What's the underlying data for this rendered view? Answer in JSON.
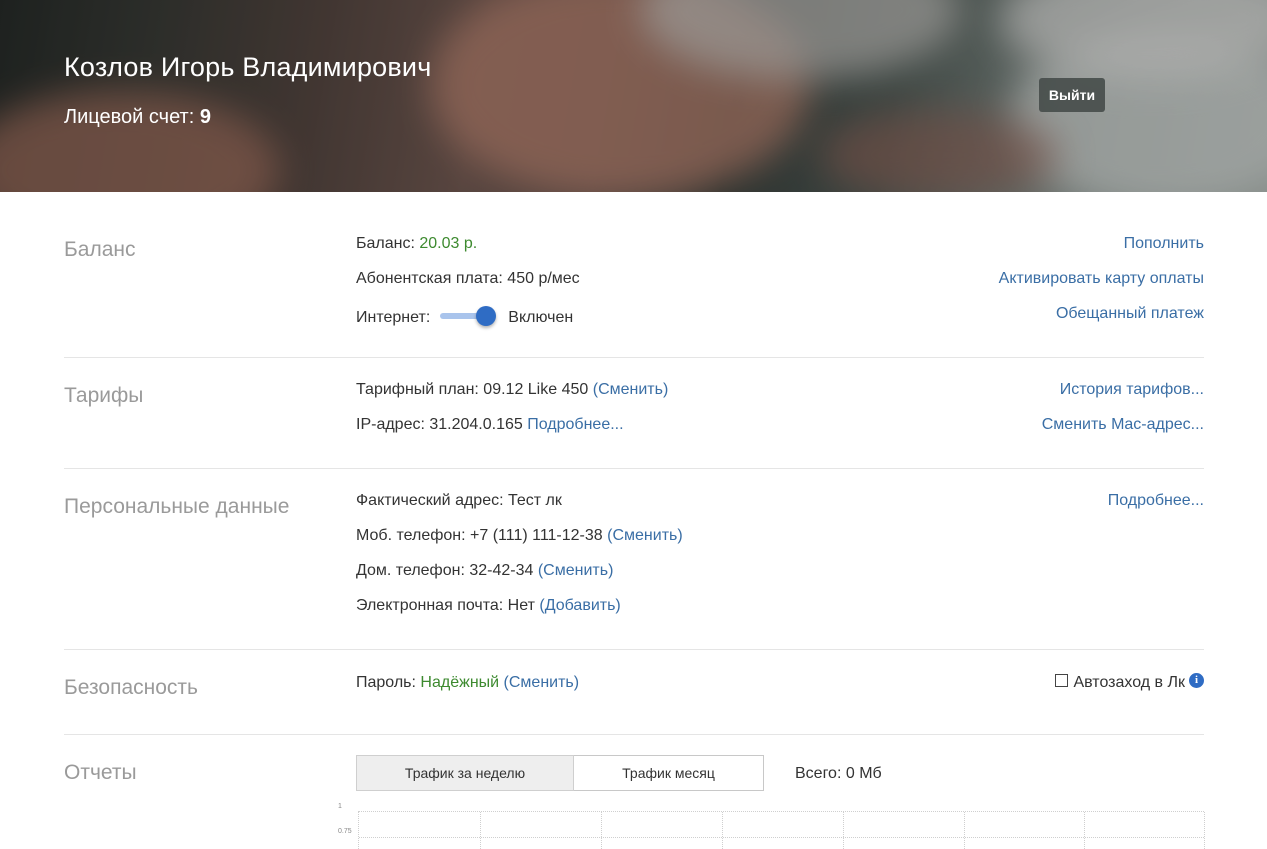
{
  "header": {
    "user_name": "Козлов Игорь Владимирович",
    "account_label": "Лицевой счет:",
    "account_number": "9",
    "logout_label": "Выйти"
  },
  "balance": {
    "title": "Баланс",
    "balance_label": "Баланс:",
    "balance_value": "20.03 р.",
    "fee_text": "Абонентская плата: 450 р/мес",
    "internet_label": "Интернет:",
    "internet_on": true,
    "internet_status": "Включен",
    "links": [
      "Пополнить",
      "Активировать карту оплаты",
      "Обещанный платеж"
    ]
  },
  "tariffs": {
    "title": "Тарифы",
    "plan_text": "Тарифный план: 09.12 Like 450",
    "plan_change": "(Сменить)",
    "ip_text": "IP-адрес: 31.204.0.165",
    "ip_more": "Подробнее...",
    "links": [
      "История тарифов...",
      "Сменить Mac-адрес..."
    ]
  },
  "personal": {
    "title": "Персональные данные",
    "address_text": "Фактический адрес: Тест лк",
    "mobile_text": "Моб. телефон: +7 (111) 111-12-38",
    "mobile_change": "(Сменить)",
    "home_text": "Дом. телефон: 32-42-34",
    "home_change": "(Сменить)",
    "email_text": "Электронная почта: Нет",
    "email_add": "(Добавить)",
    "more_link": "Подробнее..."
  },
  "security": {
    "title": "Безопасность",
    "password_label": "Пароль:",
    "password_value": "Надёжный",
    "password_change": "(Сменить)",
    "autologin_label": "Автозаход в Лк",
    "autologin_checked": false
  },
  "reports": {
    "title": "Отчеты",
    "tabs": [
      "Трафик за неделю",
      "Трафик месяц"
    ],
    "active_tab": 0,
    "total_text": "Всего: 0 Мб",
    "y_ticks": [
      "1",
      "0.75"
    ]
  },
  "icons": {
    "toggle": "toggle-switch",
    "checkbox": "checkbox-unchecked",
    "info": "info-circle-icon"
  },
  "colors": {
    "link": "#3a6ea5",
    "positive": "#3d8a2f",
    "toggle_accent": "#2f6cc4",
    "section_title": "#9a9a9a"
  }
}
